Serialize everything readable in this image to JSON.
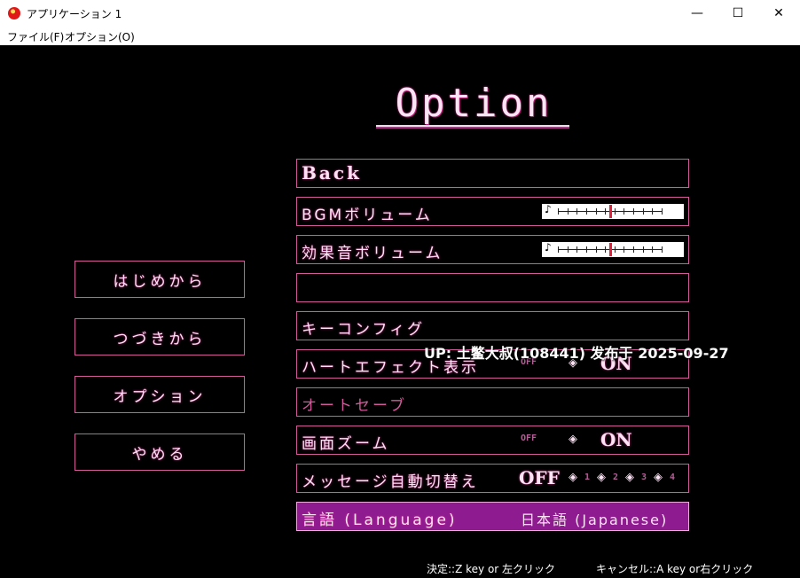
{
  "window": {
    "title": "アプリケーション 1",
    "minimize": "—",
    "maximize": "☐",
    "close": "✕"
  },
  "menu": {
    "file": "ファイル(F)",
    "option": "オプション(O)"
  },
  "screen": {
    "title": "Option",
    "left_buttons": [
      "はじめから",
      "つづきから",
      "オプション",
      "やめる"
    ],
    "rows": {
      "back": "Back",
      "bgm": "BGMボリューム",
      "se": "効果音ボリューム",
      "keyconfig": "キーコンフィグ",
      "heart": "ハートエフェクト表示",
      "autosave": "オートセーブ",
      "zoom": "画面ズーム",
      "message": "メッセージ自動切替え",
      "language": "言語 (Language)"
    },
    "bgm_volume_fraction": 0.5,
    "se_volume_fraction": 0.5,
    "heart": {
      "off": "OFF",
      "on": "ON",
      "selected": "ON"
    },
    "zoom": {
      "off": "OFF",
      "on": "ON",
      "selected": "ON"
    },
    "message": {
      "off": "OFF",
      "levels": [
        "1",
        "2",
        "3",
        "4"
      ],
      "selected": "OFF"
    },
    "language_value": "日本語 (Japanese)",
    "note_icon": "♪",
    "diamond_icon": "◈"
  },
  "overlay": "UP: 土鳖大叔(108441) 发布于 2025-09-27",
  "help": {
    "confirm": "決定::Z key or 左クリック",
    "cancel": "キャンセル::A key or右クリック"
  },
  "colors": {
    "accent": "#d05a9a",
    "selected_bg": "#8e1c90",
    "text": "#fbe3f3"
  }
}
